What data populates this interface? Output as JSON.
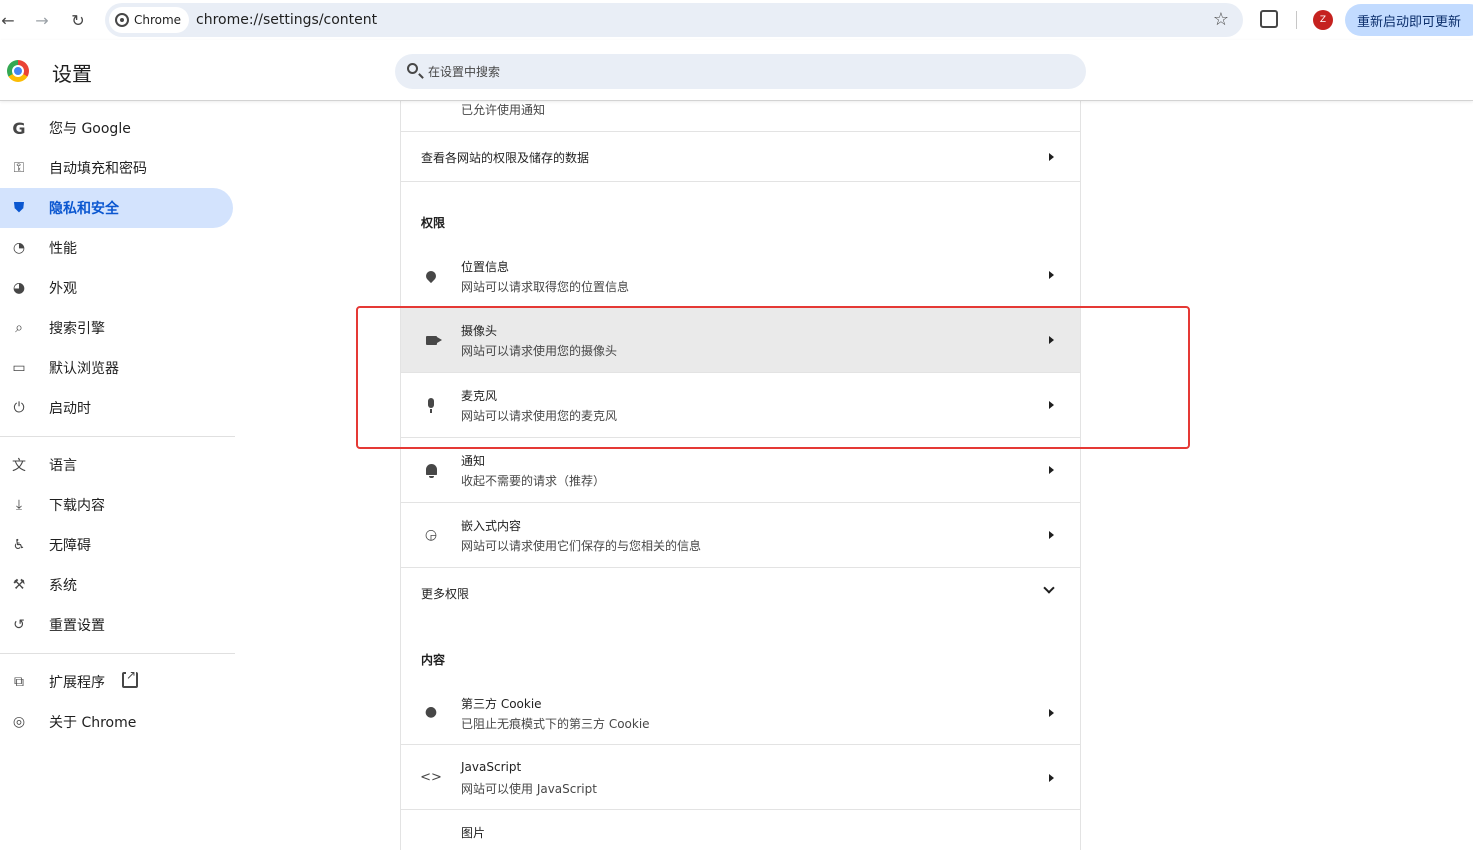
{
  "browser": {
    "chip_label": "Chrome",
    "url": "chrome://settings/content",
    "update_label": "重新启动即可更新",
    "avatar_letter": "Z"
  },
  "header": {
    "title": "设置",
    "search_placeholder": "在设置中搜索"
  },
  "sidebar": {
    "items": [
      {
        "label": "您与 Google",
        "icon": "google-g-icon"
      },
      {
        "label": "自动填充和密码",
        "icon": "key-icon"
      },
      {
        "label": "隐私和安全",
        "icon": "shield-icon",
        "active": true
      },
      {
        "label": "性能",
        "icon": "speedometer-icon"
      },
      {
        "label": "外观",
        "icon": "palette-icon"
      },
      {
        "label": "搜索引擎",
        "icon": "search-icon"
      },
      {
        "label": "默认浏览器",
        "icon": "browser-window-icon"
      },
      {
        "label": "启动时",
        "icon": "power-icon"
      },
      {
        "label": "语言",
        "icon": "translate-icon"
      },
      {
        "label": "下载内容",
        "icon": "download-icon"
      },
      {
        "label": "无障碍",
        "icon": "accessibility-icon"
      },
      {
        "label": "系统",
        "icon": "wrench-icon"
      },
      {
        "label": "重置设置",
        "icon": "reset-icon"
      },
      {
        "label": "扩展程序",
        "icon": "puzzle-icon"
      },
      {
        "label": "关于 Chrome",
        "icon": "chrome-logo-icon"
      }
    ]
  },
  "main": {
    "partial_row_sub": "已允许使用通知",
    "site_data_row": "查看各网站的权限及储存的数据",
    "permissions_heading": "权限",
    "permissions": [
      {
        "title": "位置信息",
        "sub": "网站可以请求取得您的位置信息",
        "icon": "location-pin-icon"
      },
      {
        "title": "摄像头",
        "sub": "网站可以请求使用您的摄像头",
        "icon": "camera-icon"
      },
      {
        "title": "麦克风",
        "sub": "网站可以请求使用您的麦克风",
        "icon": "microphone-icon"
      },
      {
        "title": "通知",
        "sub": "收起不需要的请求（推荐）",
        "icon": "bell-icon"
      },
      {
        "title": "嵌入式内容",
        "sub": "网站可以请求使用它们保存的与您相关的信息",
        "icon": "embedded-content-icon"
      }
    ],
    "more_permissions": "更多权限",
    "content_heading": "内容",
    "content": [
      {
        "title": "第三方 Cookie",
        "sub": "已阻止无痕模式下的第三方 Cookie",
        "icon": "cookie-icon"
      },
      {
        "title": "JavaScript",
        "sub": "网站可以使用 JavaScript",
        "icon": "code-icon"
      },
      {
        "title": "图片",
        "icon": "image-icon"
      }
    ]
  },
  "colors": {
    "active_nav_bg": "#d3e3fd",
    "active_nav_text": "#0b57d0",
    "highlight_box": "#e53935",
    "update_button_bg": "#c2dbff"
  }
}
